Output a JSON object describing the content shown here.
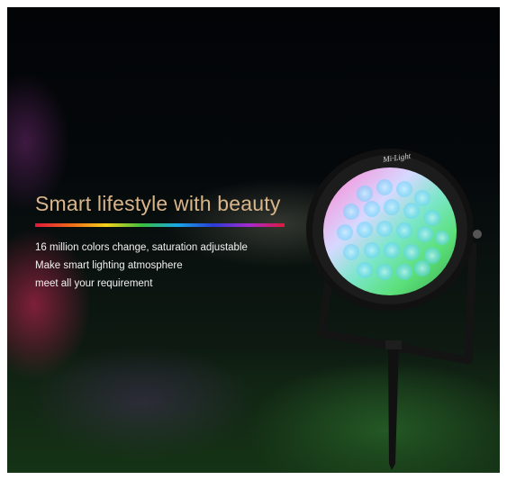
{
  "hero": {
    "headline": "Smart lifestyle with beauty",
    "lines": [
      "16 million colors change, saturation adjustable",
      "Make smart lighting atmosphere",
      "meet all your requirement"
    ]
  },
  "product": {
    "brand": "Mi·Light",
    "icon": "rgbcct-spotlight-icon"
  },
  "colors": {
    "headline": "#d9b58a",
    "body_text": "#f2f2f2",
    "background": "#05080b"
  }
}
